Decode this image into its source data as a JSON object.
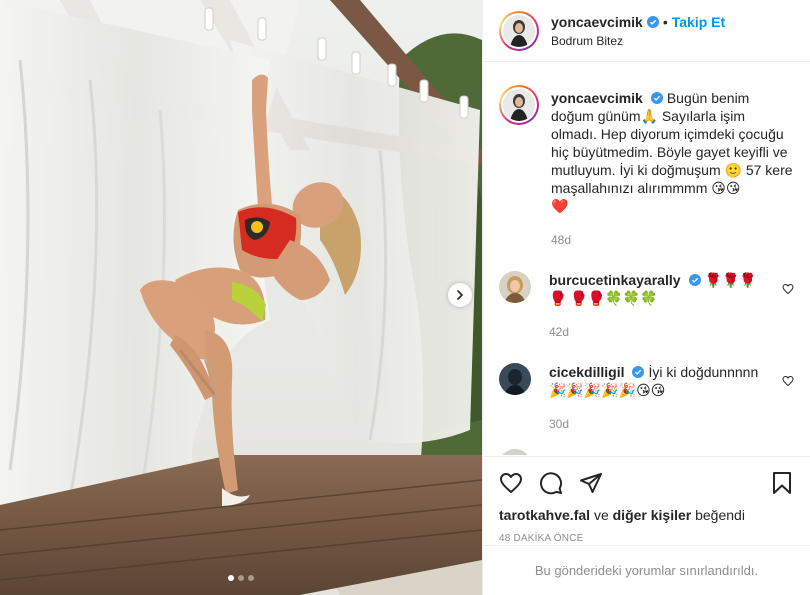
{
  "header": {
    "username": "yoncaevcimik",
    "separator": "•",
    "follow_label": "Takip Et",
    "location": "Bodrum Bitez"
  },
  "caption": {
    "username": "yoncaevcimik",
    "text_1": "Bugün benim doğum günüm",
    "emoji_pray": "🙏",
    "text_2": " Sayılarla işim olmadı. Hep diyorum içimdeki çocuğu hiç büyütmedim. Böyle gayet keyifli ve mutluyum. İyi ki doğmuşum ",
    "emoji_smile": "🙂",
    "text_3": " 57 kere maşallahınızı alırımmmm ",
    "emoji_tail": "😘😘",
    "emoji_heart": "❤️",
    "time": "48d"
  },
  "comments": [
    {
      "username": "burcucetinkayarally",
      "text": "🌹🌹🌹🥊 🥊🥊🍀🍀🍀",
      "time": "42d"
    },
    {
      "username": "cicekdilligil",
      "text": "İyi ki doğdunnnnn 🎉🎉🎉🎉🎉😘😘",
      "time": "30d"
    }
  ],
  "likes": {
    "first_user": "tarotkahve.fal",
    "connector": "ve",
    "others": "diğer kişiler",
    "suffix": "beğendi"
  },
  "time_ago": "48 DAKİKA ÖNCE",
  "restricted_notice": "Bu gönderideki yorumlar sınırlandırıldı.",
  "carousel": {
    "total": 3,
    "active_index": 0
  },
  "icons": [
    "heart-icon",
    "comment-icon",
    "share-icon",
    "bookmark-icon",
    "chevron-right-icon",
    "verified-icon"
  ],
  "colors": {
    "link_blue": "#0095f6",
    "verified_blue": "#3897f0",
    "muted": "#8e8e8e",
    "text": "#262626"
  }
}
